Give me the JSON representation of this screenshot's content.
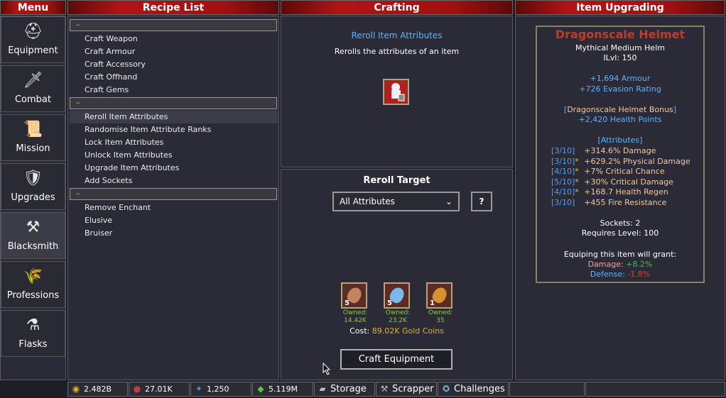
{
  "headers": {
    "menu": "Menu",
    "recipe_list": "Recipe List",
    "crafting": "Crafting",
    "item_upgrading": "Item Upgrading"
  },
  "menu": [
    {
      "label": "Equipment",
      "icon": "helmet-icon",
      "glyph": "⛑"
    },
    {
      "label": "Combat",
      "icon": "sword-icon",
      "glyph": "🗡"
    },
    {
      "label": "Mission",
      "icon": "scroll-icon",
      "glyph": "📜"
    },
    {
      "label": "Upgrades",
      "icon": "shield-icon",
      "glyph": "🛡"
    },
    {
      "label": "Blacksmith",
      "icon": "anvil-icon",
      "glyph": "⚒"
    },
    {
      "label": "Professions",
      "icon": "wheat-icon",
      "glyph": "🌾"
    },
    {
      "label": "Flasks",
      "icon": "potion-icon",
      "glyph": "⚗"
    }
  ],
  "recipes": {
    "cat1": "–",
    "cat2": "–",
    "cat3": "–",
    "group1": [
      "Craft Weapon",
      "Craft Armour",
      "Craft Accessory",
      "Craft Offhand",
      "Craft Gems"
    ],
    "group2": [
      "Reroll Item Attributes",
      "Randomise Item Attribute Ranks",
      "Lock Item Attributes",
      "Unlock Item Attributes",
      "Upgrade Item Attributes",
      "Add Sockets"
    ],
    "group3": [
      "Remove Enchant",
      "Elusive",
      "Bruiser"
    ]
  },
  "crafting": {
    "title": "Reroll Item Attributes",
    "description": "Rerolls the attributes of an item",
    "target_label": "Reroll Target",
    "target_value": "All Attributes",
    "help_button": "?",
    "materials": [
      {
        "count": "5",
        "owned_label": "Owned:",
        "owned": "14.42K",
        "color": "#c2845c"
      },
      {
        "count": "5",
        "owned_label": "Owned:",
        "owned": "23.2K",
        "color": "#7ab8e8"
      },
      {
        "count": "1",
        "owned_label": "Owned:",
        "owned": "35",
        "color": "#d89030"
      }
    ],
    "cost_label": "Cost:",
    "cost_value": "89.02K Gold Coins",
    "craft_button": "Craft Equipment"
  },
  "item": {
    "name": "Dragonscale Helmet",
    "type": "Mythical Medium Helm",
    "ilvl": "ILvl: 150",
    "stats": [
      "+1,694 Armour",
      "+726 Evasion Rating"
    ],
    "bonus_open": "[",
    "bonus_title": "Dragonscale Helmet Bonus",
    "bonus_close": "]",
    "bonus_value": "+2,420 Health Points",
    "attributes_title": "[Attributes]",
    "attributes": [
      {
        "rank": "[3/10]",
        "star": "",
        "text": "+314.6% Damage"
      },
      {
        "rank": "[3/10]",
        "star": "*",
        "text": "+629.2% Physical Damage"
      },
      {
        "rank": "[4/10]",
        "star": "*",
        "text": "+7% Critical Chance"
      },
      {
        "rank": "[5/10]",
        "star": "*",
        "text": "+30% Critical Damage"
      },
      {
        "rank": "[4/10]",
        "star": "*",
        "text": "+168.7 Health Regen"
      },
      {
        "rank": "[3/10]",
        "star": "",
        "text": "+455 Fire Resistance"
      }
    ],
    "sockets": "Sockets: 2",
    "requires": "Requires Level: 100",
    "grant_title": "Equiping this item will grant:",
    "damage_label": "Damage:",
    "damage_value": "+8.2%",
    "defense_label": "Defense:",
    "defense_value": "-1.8%"
  },
  "bottom_bar": {
    "gold": "2.482B",
    "meat": "27.01K",
    "gems": "1,250",
    "emerald": "5.119M",
    "storage": "Storage",
    "scrapper": "Scrapper",
    "challenges": "Challenges"
  },
  "colors": {
    "header_red": "#b21414",
    "item_name": "#c23a2a",
    "stat_blue": "#5ab4ff",
    "rank_blue": "#4aa0ff",
    "star_gold": "#d8c050",
    "attr_peach": "#f4c8a0",
    "cost_gold": "#e0b030",
    "owned_green": "#8ac84a",
    "positive": "#4ab84a",
    "negative": "#e03a2a"
  }
}
